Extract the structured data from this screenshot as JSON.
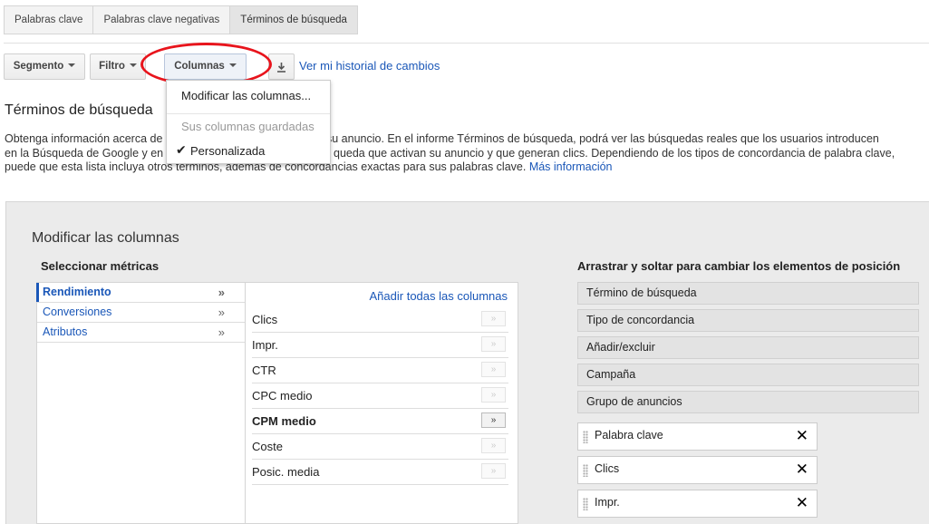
{
  "tabs": [
    "Palabras clave",
    "Palabras clave negativas",
    "Términos de búsqueda"
  ],
  "toolbar": {
    "segment_label": "Segmento",
    "filter_label": "Filtro",
    "columns_label": "Columnas",
    "download_icon": "download-icon",
    "history_link": "Ver mi historial de cambios"
  },
  "columns_menu": {
    "modify": "Modificar las columnas...",
    "saved_header": "Sus columnas guardadas",
    "custom": "Personalizada"
  },
  "page": {
    "title": "Términos de búsqueda",
    "desc_1": "Obtenga información acerca de",
    "desc_1b": "su anuncio. En el informe Términos de búsqueda, podrá ver las búsquedas reales que los usuarios introducen",
    "desc_2a": "en la Búsqueda de Google y en",
    "desc_2b": "queda que activan su anuncio y que generan clics. Dependiendo de los tipos de concordancia de palabra clave,",
    "desc_3": "puede que esta lista incluya otros términos, además de concordancias exactas para sus palabras clave.",
    "more_info": "Más información"
  },
  "editor": {
    "title": "Modificar las columnas",
    "select_metrics": "Seleccionar métricas",
    "drag_title": "Arrastrar y soltar para cambiar los elementos de posición",
    "add_all": "Añadir todas las columnas",
    "categories": [
      {
        "label": "Rendimiento",
        "arrow": "»"
      },
      {
        "label": "Conversiones",
        "arrow": "»"
      },
      {
        "label": "Atributos",
        "arrow": "»"
      }
    ],
    "metrics": [
      {
        "label": "Clics",
        "add": "»"
      },
      {
        "label": "Impr.",
        "add": "»"
      },
      {
        "label": "CTR",
        "add": "»"
      },
      {
        "label": "CPC medio",
        "add": "»"
      },
      {
        "label": "CPM medio",
        "add": "»"
      },
      {
        "label": "Coste",
        "add": "»"
      },
      {
        "label": "Posic. media",
        "add": "»"
      }
    ],
    "fixed_columns": [
      "Término de búsqueda",
      "Tipo de concordancia",
      "Añadir/excluir",
      "Campaña",
      "Grupo de anuncios"
    ],
    "selected_columns": [
      {
        "label": "Palabra clave",
        "remove": "✕"
      },
      {
        "label": "Clics",
        "remove": "✕"
      },
      {
        "label": "Impr.",
        "remove": "✕"
      }
    ]
  },
  "colors": {
    "link": "#1a57b8",
    "highlight_circle": "#e8141c",
    "panel_bg": "#ebebeb"
  }
}
